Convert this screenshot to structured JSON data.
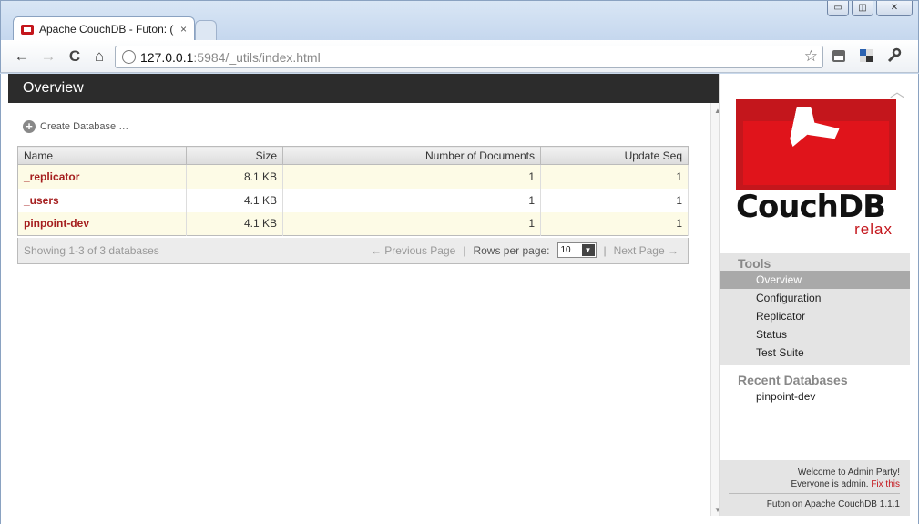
{
  "window": {
    "tab_title": "Apache CouchDB - Futon: (",
    "tab_close": "×",
    "minimize": "▭",
    "maximize": "◫",
    "close": "✕"
  },
  "toolbar": {
    "url_host": "127.0.0.1",
    "url_rest": ":5984/_utils/index.html",
    "back_glyph": "←",
    "forward_glyph": "→",
    "reload_glyph": "C",
    "home_glyph": "⌂",
    "star_glyph": "☆"
  },
  "main": {
    "header_title": "Overview",
    "create_db_label": "Create Database …",
    "columns": [
      "Name",
      "Size",
      "Number of Documents",
      "Update Seq"
    ],
    "rows": [
      {
        "name": "_replicator",
        "size": "8.1 KB",
        "docs": "1",
        "seq": "1"
      },
      {
        "name": "_users",
        "size": "4.1 KB",
        "docs": "1",
        "seq": "1"
      },
      {
        "name": "pinpoint-dev",
        "size": "4.1 KB",
        "docs": "1",
        "seq": "1"
      }
    ],
    "footer": {
      "showing": "Showing 1-3 of 3 databases",
      "prev": "← Previous Page",
      "sep": "|",
      "rows_label": "Rows per page:",
      "rows_value": "10",
      "next": "Next Page →"
    }
  },
  "sidebar": {
    "logo_text": "CouchDB",
    "logo_tagline": "relax",
    "tools_title": "Tools",
    "tools": [
      "Overview",
      "Configuration",
      "Replicator",
      "Status",
      "Test Suite"
    ],
    "recent_title": "Recent Databases",
    "recent": [
      "pinpoint-dev"
    ],
    "welcome_line1": "Welcome to Admin Party!",
    "welcome_line2": "Everyone is admin.",
    "fix_link": "Fix this",
    "version": "Futon on Apache CouchDB 1.1.1"
  },
  "colors": {
    "header_bg": "#2c2c2c",
    "db_name": "#a51e1e",
    "brand_red": "#c4161c",
    "active_nav": "#a9a9a9"
  }
}
